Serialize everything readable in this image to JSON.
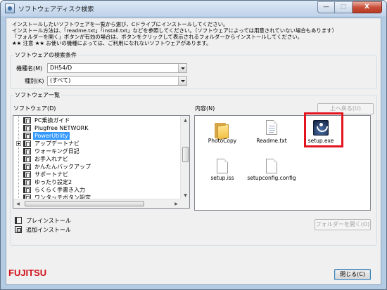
{
  "window": {
    "title": "ソフトウェアディスク検索",
    "caption_minimize": "—",
    "caption_maximize": "□",
    "caption_close": "X"
  },
  "instructions": [
    "インストールしたいソフトウェアを一覧から選び、Cドライブにインストールしてください。",
    "インストール方法は、「readme.txt」「install.txt」などを参照してください。（ソフトウェアによっては用意されていない場合もあります）",
    "「フォルダーを開く」ボタンが有効の場合は、ボタンをクリックして表示されるフォルダーからインストールしてください。",
    "★★ 注意 ★★ お使いの機種によっては、ご利用になれないソフトウェアがあります。"
  ],
  "search": {
    "group_label": "ソフトウェアの検索条件",
    "model_label": "機種名(M)",
    "model_value": "DH54/D",
    "type_label": "種別(K)",
    "type_value": "(すべて)"
  },
  "software_list": {
    "group_label": "ソフトウェア一覧",
    "tree_label": "ソフトウェア(D)",
    "items": [
      {
        "label": "PC乗換ガイド",
        "expander": false,
        "selected": false
      },
      {
        "label": "Plugfree NETWORK",
        "expander": false,
        "selected": false
      },
      {
        "label": "PowerUtility",
        "expander": false,
        "selected": true
      },
      {
        "label": "アップデートナビ",
        "expander": true,
        "selected": false
      },
      {
        "label": "ウォーキング日記",
        "expander": false,
        "selected": false
      },
      {
        "label": "お手入れナビ",
        "expander": false,
        "selected": false
      },
      {
        "label": "かんたんバックアップ",
        "expander": false,
        "selected": false
      },
      {
        "label": "サポートナビ",
        "expander": false,
        "selected": false
      },
      {
        "label": "ゆったり設定2",
        "expander": false,
        "selected": false
      },
      {
        "label": "らくらく手書き入力",
        "expander": false,
        "selected": false
      },
      {
        "label": "ワンタッチボタン設定",
        "expander": false,
        "selected": false
      }
    ],
    "contents_label": "内容(N)",
    "up_button": "上へ戻る(U)",
    "files": [
      {
        "name": "PhotoCopy",
        "icon": "folder-icon"
      },
      {
        "name": "Readme.txt",
        "icon": "text-file-icon"
      },
      {
        "name": "setup.exe",
        "icon": "setup-exe-icon"
      },
      {
        "name": "setup.iss",
        "icon": "file-icon"
      },
      {
        "name": "setupconfig.config",
        "icon": "file-icon"
      }
    ],
    "legend_preinstall": "プレインストール",
    "legend_additional": "追加インストール",
    "open_folder_button": "フォルダーを開く(O)"
  },
  "footer": {
    "brand": "FUJITSU",
    "close_button": "閉じる(C)"
  },
  "colors": {
    "selection": "#3399ff",
    "highlight": "#e3141e",
    "brand": "#d0101b"
  }
}
